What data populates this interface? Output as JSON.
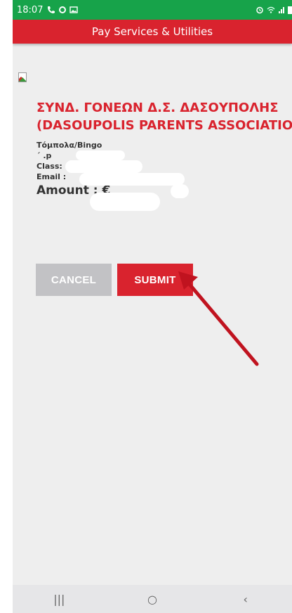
{
  "status_bar": {
    "time": "18:07",
    "left_icons": [
      "phone-icon",
      "whatsapp-icon",
      "image-icon"
    ],
    "right_icons": [
      "alarm-icon",
      "wifi-icon",
      "signal-icon",
      "battery-icon"
    ]
  },
  "header": {
    "title": "Pay Services & Utilities"
  },
  "merchant": {
    "name_line1": "ΣΥΝΔ. ΓΟΝΕΩΝ Δ.Σ. ΔΑΣΟΥΠΟΛΗΣ",
    "name_line2": "(DASOUPOLIS PARENTS ASSOCIATION)"
  },
  "details": {
    "service": "Τόμπολα/Βingo",
    "student_partial": "  ´  .p",
    "class_label": "Class:",
    "email_label": "Email :",
    "amount_label": "Amount : €"
  },
  "buttons": {
    "cancel": "CANCEL",
    "submit": "SUBMIT"
  },
  "nav": {
    "recents": "|||",
    "home": "○",
    "back": "‹"
  },
  "colors": {
    "brand_red": "#d9232e",
    "status_green": "#17a34a",
    "cancel_gray": "#c2c2c5",
    "arrow_red": "#c0131f"
  }
}
